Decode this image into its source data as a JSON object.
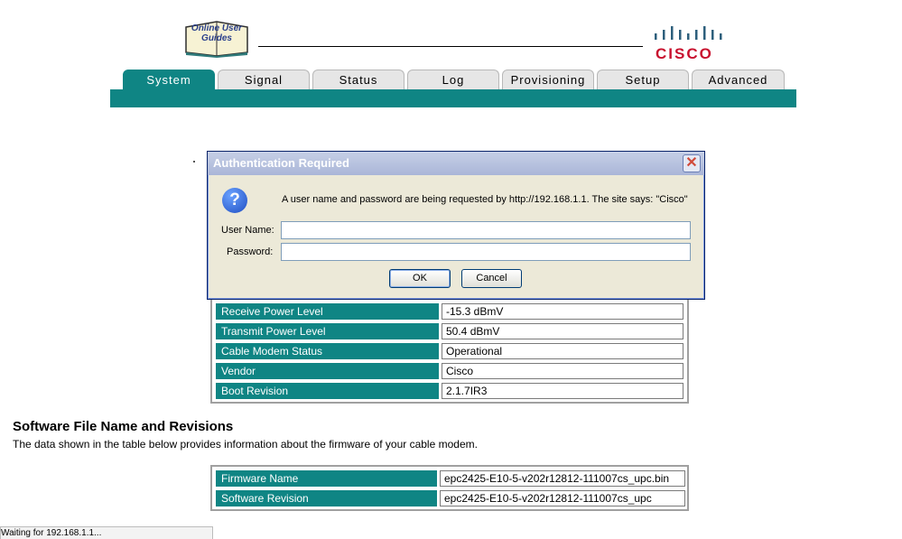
{
  "header": {
    "guide_logo_text": "Online User Guides",
    "cisco_logo_text": "CISCO"
  },
  "tabs": [
    {
      "label": "System",
      "active": true
    },
    {
      "label": "Signal",
      "active": false
    },
    {
      "label": "Status",
      "active": false
    },
    {
      "label": "Log",
      "active": false
    },
    {
      "label": "Provisioning",
      "active": false
    },
    {
      "label": "Setup",
      "active": false
    },
    {
      "label": "Advanced",
      "active": false
    }
  ],
  "system_table": [
    {
      "label": "Receive Power Level",
      "value": "-15.3 dBmV"
    },
    {
      "label": "Transmit Power Level",
      "value": "50.4 dBmV"
    },
    {
      "label": "Cable Modem Status",
      "value": "Operational"
    },
    {
      "label": "Vendor",
      "value": "Cisco"
    },
    {
      "label": "Boot Revision",
      "value": "2.1.7IR3"
    }
  ],
  "software_section": {
    "title": "Software File Name and Revisions",
    "description": "The data shown in the table below provides information about the firmware of your cable modem.",
    "rows": [
      {
        "label": "Firmware Name",
        "value": "epc2425-E10-5-v202r12812-111007cs_upc.bin"
      },
      {
        "label": "Software Revision",
        "value": "epc2425-E10-5-v202r12812-111007cs_upc"
      }
    ]
  },
  "dialog": {
    "title": "Authentication Required",
    "message": "A user name and password are being requested by http://192.168.1.1. The site says: \"Cisco\"",
    "username_label": "User Name:",
    "password_label": "Password:",
    "username_value": "",
    "password_value": "",
    "ok_label": "OK",
    "cancel_label": "Cancel"
  },
  "statusbar": {
    "text": "Waiting for 192.168.1.1..."
  },
  "colors": {
    "teal": "#0f8584",
    "cisco_red": "#c8102e"
  }
}
